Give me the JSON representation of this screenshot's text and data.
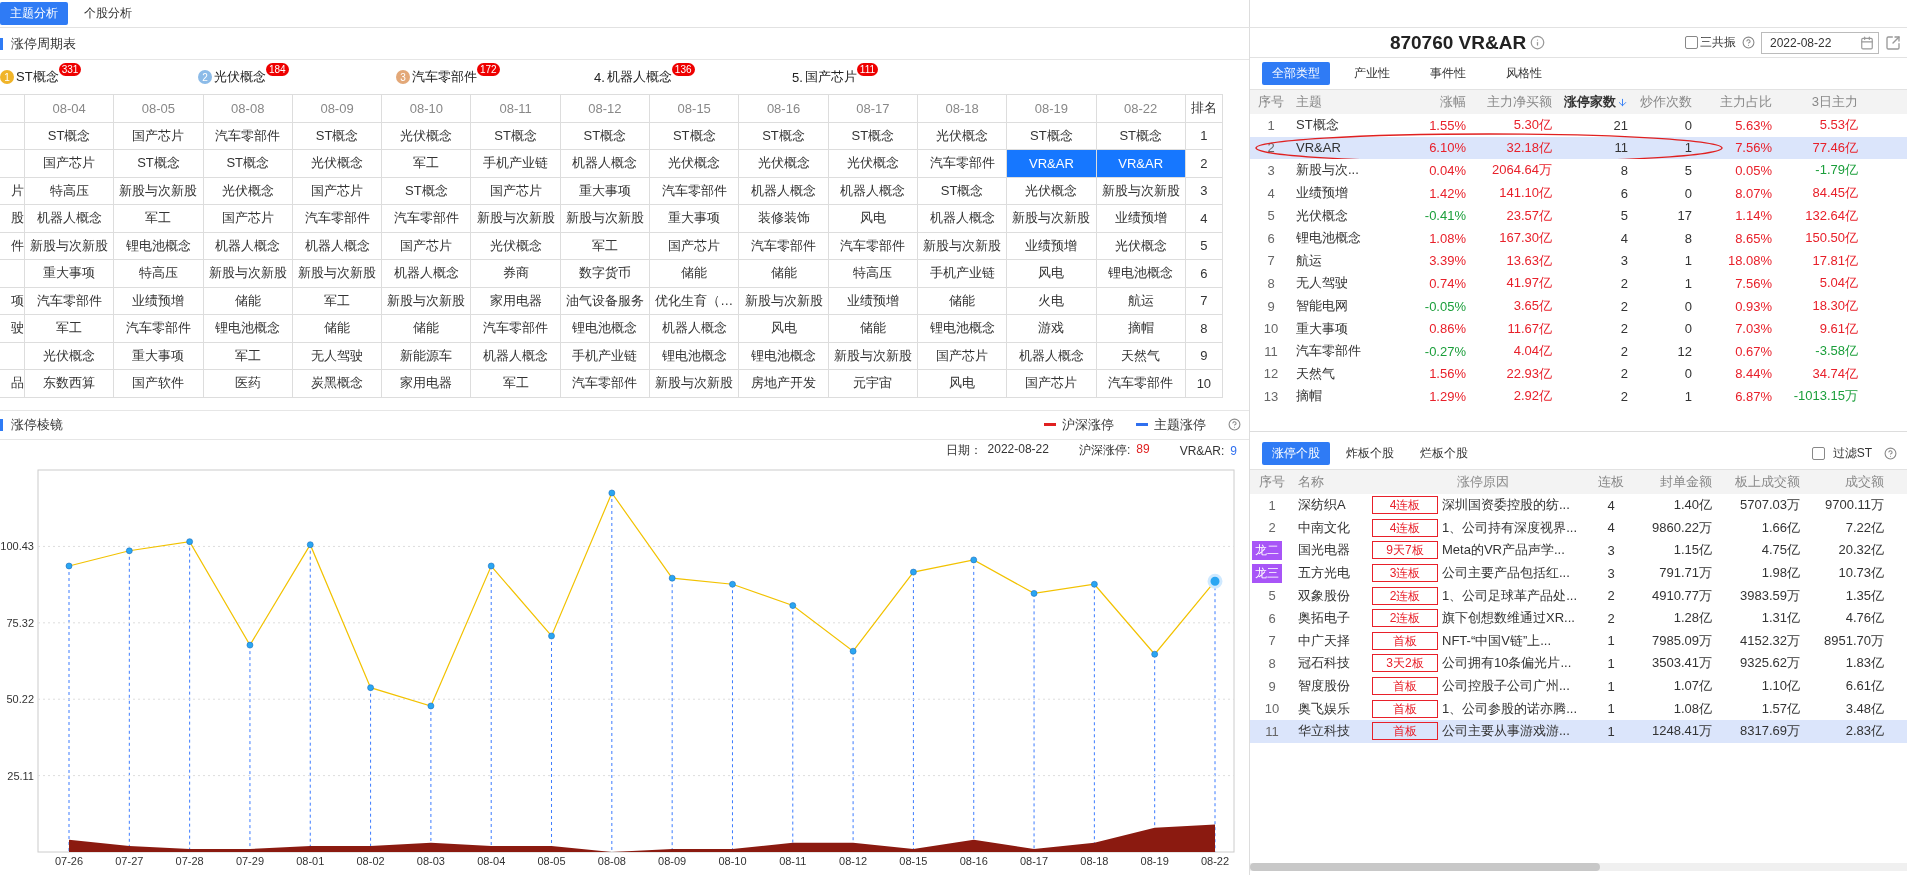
{
  "top_tabs": [
    {
      "label": "主题分析",
      "selected": true
    },
    {
      "label": "个股分析",
      "selected": false
    }
  ],
  "cycle": {
    "title": "涨停周期表",
    "leaders": [
      {
        "kind": "medal",
        "rank": "1",
        "color": "#f0b429",
        "name": "ST概念",
        "count": "331"
      },
      {
        "kind": "medal",
        "rank": "2",
        "color": "#8cbbe8",
        "name": "光伏概念",
        "count": "184"
      },
      {
        "kind": "medal",
        "rank": "3",
        "color": "#e3a878",
        "name": "汽车零部件",
        "count": "172"
      },
      {
        "kind": "plain",
        "rank": "4.",
        "name": "机器人概念",
        "count": "136"
      },
      {
        "kind": "plain",
        "rank": "5.",
        "name": "国产芯片",
        "count": "111"
      }
    ],
    "dates": [
      "08-04",
      "08-05",
      "08-08",
      "08-09",
      "08-10",
      "08-11",
      "08-12",
      "08-15",
      "08-16",
      "08-17",
      "08-18",
      "08-19",
      "08-22"
    ],
    "rank_header": "排名",
    "rows": [
      {
        "rank": "1",
        "cells": [
          {
            "text": "ST概念",
            "selected": false
          },
          {
            "text": "国产芯片",
            "selected": false
          },
          {
            "text": "汽车零部件",
            "selected": false
          },
          {
            "text": "ST概念",
            "selected": false
          },
          {
            "text": "光伏概念",
            "selected": false
          },
          {
            "text": "ST概念",
            "selected": false
          },
          {
            "text": "ST概念",
            "selected": false
          },
          {
            "text": "ST概念",
            "selected": false
          },
          {
            "text": "ST概念",
            "selected": false
          },
          {
            "text": "ST概念",
            "selected": false
          },
          {
            "text": "光伏概念",
            "selected": false
          },
          {
            "text": "ST概念",
            "selected": false
          },
          {
            "text": "ST概念",
            "selected": false
          }
        ]
      },
      {
        "rank": "2",
        "cells": [
          {
            "text": "国产芯片",
            "selected": false
          },
          {
            "text": "ST概念",
            "selected": false
          },
          {
            "text": "ST概念",
            "selected": false
          },
          {
            "text": "光伏概念",
            "selected": false
          },
          {
            "text": "军工",
            "selected": false
          },
          {
            "text": "手机产业链",
            "selected": false
          },
          {
            "text": "机器人概念",
            "selected": false
          },
          {
            "text": "光伏概念",
            "selected": false
          },
          {
            "text": "光伏概念",
            "selected": false
          },
          {
            "text": "光伏概念",
            "selected": false
          },
          {
            "text": "汽车零部件",
            "selected": false
          },
          {
            "text": "VR&AR",
            "selected": true
          },
          {
            "text": "VR&AR",
            "selected": true
          }
        ]
      },
      {
        "rank": "3",
        "cut": "片",
        "cells": [
          {
            "text": "特高压",
            "selected": false
          },
          {
            "text": "新股与次新股",
            "selected": false
          },
          {
            "text": "光伏概念",
            "selected": false
          },
          {
            "text": "国产芯片",
            "selected": false
          },
          {
            "text": "ST概念",
            "selected": false
          },
          {
            "text": "国产芯片",
            "selected": false
          },
          {
            "text": "重大事项",
            "selected": false
          },
          {
            "text": "汽车零部件",
            "selected": false
          },
          {
            "text": "机器人概念",
            "selected": false
          },
          {
            "text": "机器人概念",
            "selected": false
          },
          {
            "text": "ST概念",
            "selected": false
          },
          {
            "text": "光伏概念",
            "selected": false
          },
          {
            "text": "新股与次新股",
            "selected": false
          }
        ]
      },
      {
        "rank": "4",
        "cut": "股",
        "cells": [
          {
            "text": "机器人概念",
            "selected": false
          },
          {
            "text": "军工",
            "selected": false
          },
          {
            "text": "国产芯片",
            "selected": false
          },
          {
            "text": "汽车零部件",
            "selected": false
          },
          {
            "text": "汽车零部件",
            "selected": false
          },
          {
            "text": "新股与次新股",
            "selected": false
          },
          {
            "text": "新股与次新股",
            "selected": false
          },
          {
            "text": "重大事项",
            "selected": false
          },
          {
            "text": "装修装饰",
            "selected": false
          },
          {
            "text": "风电",
            "selected": false
          },
          {
            "text": "机器人概念",
            "selected": false
          },
          {
            "text": "新股与次新股",
            "selected": false
          },
          {
            "text": "业绩预增",
            "selected": false
          }
        ]
      },
      {
        "rank": "5",
        "cut": "件",
        "cells": [
          {
            "text": "新股与次新股",
            "selected": false
          },
          {
            "text": "锂电池概念",
            "selected": false
          },
          {
            "text": "机器人概念",
            "selected": false
          },
          {
            "text": "机器人概念",
            "selected": false
          },
          {
            "text": "国产芯片",
            "selected": false
          },
          {
            "text": "光伏概念",
            "selected": false
          },
          {
            "text": "军工",
            "selected": false
          },
          {
            "text": "国产芯片",
            "selected": false
          },
          {
            "text": "汽车零部件",
            "selected": false
          },
          {
            "text": "汽车零部件",
            "selected": false
          },
          {
            "text": "新股与次新股",
            "selected": false
          },
          {
            "text": "业绩预增",
            "selected": false
          },
          {
            "text": "光伏概念",
            "selected": false
          }
        ]
      },
      {
        "rank": "6",
        "cells": [
          {
            "text": "重大事项",
            "selected": false
          },
          {
            "text": "特高压",
            "selected": false
          },
          {
            "text": "新股与次新股",
            "selected": false
          },
          {
            "text": "新股与次新股",
            "selected": false
          },
          {
            "text": "机器人概念",
            "selected": false
          },
          {
            "text": "券商",
            "selected": false
          },
          {
            "text": "数字货币",
            "selected": false
          },
          {
            "text": "储能",
            "selected": false
          },
          {
            "text": "储能",
            "selected": false
          },
          {
            "text": "特高压",
            "selected": false
          },
          {
            "text": "手机产业链",
            "selected": false
          },
          {
            "text": "风电",
            "selected": false
          },
          {
            "text": "锂电池概念",
            "selected": false
          }
        ]
      },
      {
        "rank": "7",
        "cut": "项",
        "cells": [
          {
            "text": "汽车零部件",
            "selected": false
          },
          {
            "text": "业绩预增",
            "selected": false
          },
          {
            "text": "储能",
            "selected": false
          },
          {
            "text": "军工",
            "selected": false
          },
          {
            "text": "新股与次新股",
            "selected": false
          },
          {
            "text": "家用电器",
            "selected": false
          },
          {
            "text": "油气设备服务",
            "selected": false
          },
          {
            "text": "优化生育（…",
            "selected": false
          },
          {
            "text": "新股与次新股",
            "selected": false
          },
          {
            "text": "业绩预增",
            "selected": false
          },
          {
            "text": "储能",
            "selected": false
          },
          {
            "text": "火电",
            "selected": false
          },
          {
            "text": "航运",
            "selected": false
          }
        ]
      },
      {
        "rank": "8",
        "cut": "驶",
        "cells": [
          {
            "text": "军工",
            "selected": false
          },
          {
            "text": "汽车零部件",
            "selected": false
          },
          {
            "text": "锂电池概念",
            "selected": false
          },
          {
            "text": "储能",
            "selected": false
          },
          {
            "text": "储能",
            "selected": false
          },
          {
            "text": "汽车零部件",
            "selected": false
          },
          {
            "text": "锂电池概念",
            "selected": false
          },
          {
            "text": "机器人概念",
            "selected": false
          },
          {
            "text": "风电",
            "selected": false
          },
          {
            "text": "储能",
            "selected": false
          },
          {
            "text": "锂电池概念",
            "selected": false
          },
          {
            "text": "游戏",
            "selected": false
          },
          {
            "text": "摘帽",
            "selected": false
          }
        ]
      },
      {
        "rank": "9",
        "cells": [
          {
            "text": "光伏概念",
            "selected": false
          },
          {
            "text": "重大事项",
            "selected": false
          },
          {
            "text": "军工",
            "selected": false
          },
          {
            "text": "无人驾驶",
            "selected": false
          },
          {
            "text": "新能源车",
            "selected": false
          },
          {
            "text": "机器人概念",
            "selected": false
          },
          {
            "text": "手机产业链",
            "selected": false
          },
          {
            "text": "锂电池概念",
            "selected": false
          },
          {
            "text": "锂电池概念",
            "selected": false
          },
          {
            "text": "新股与次新股",
            "selected": false
          },
          {
            "text": "国产芯片",
            "selected": false
          },
          {
            "text": "机器人概念",
            "selected": false
          },
          {
            "text": "天然气",
            "selected": false
          }
        ]
      },
      {
        "rank": "10",
        "cut": "品",
        "cells": [
          {
            "text": "东数西算",
            "selected": false
          },
          {
            "text": "国产软件",
            "selected": false
          },
          {
            "text": "医药",
            "selected": false
          },
          {
            "text": "炭黑概念",
            "selected": false
          },
          {
            "text": "家用电器",
            "selected": false
          },
          {
            "text": "军工",
            "selected": false
          },
          {
            "text": "汽车零部件",
            "selected": false
          },
          {
            "text": "新股与次新股",
            "selected": false
          },
          {
            "text": "房地产开发",
            "selected": false
          },
          {
            "text": "元宇宙",
            "selected": false
          },
          {
            "text": "风电",
            "selected": false
          },
          {
            "text": "国产芯片",
            "selected": false
          },
          {
            "text": "汽车零部件",
            "selected": false
          }
        ]
      }
    ]
  },
  "prism": {
    "title": "涨停棱镜",
    "drop_lines": true,
    "legend": [
      {
        "color": "#e02020"
      },
      {
        "color": "#2f6fef"
      }
    ],
    "info": [
      {
        "label": "日期：",
        "value": "2022-08-22",
        "color": "#333333"
      },
      {
        "label": "沪深涨停:",
        "value": "89",
        "color": "#e02020"
      },
      {
        "label": "VR&AR:",
        "value": "9",
        "color": "#2f6fef"
      }
    ],
    "chart_data": {
      "type": "line",
      "categories": [
        "07-26",
        "07-27",
        "07-28",
        "07-29",
        "08-01",
        "08-02",
        "08-03",
        "08-04",
        "08-05",
        "08-08",
        "08-09",
        "08-10",
        "08-11",
        "08-12",
        "08-15",
        "08-16",
        "08-17",
        "08-18",
        "08-19",
        "08-22"
      ],
      "series": [
        {
          "name": "沪深涨停",
          "type": "line",
          "marker": true,
          "color": "#f2c200",
          "values": [
            94,
            99,
            102,
            68,
            101,
            54,
            48,
            94,
            71,
            118,
            90,
            88,
            81,
            66,
            92,
            96,
            85,
            88,
            65,
            89
          ]
        },
        {
          "name": "主题涨停",
          "type": "area",
          "color": "#8b1a10",
          "values": [
            4,
            2,
            1,
            1,
            2,
            2,
            3,
            2,
            2,
            0,
            1,
            1,
            3,
            3,
            1,
            4,
            1,
            3,
            8,
            9
          ]
        }
      ],
      "grid": true,
      "ylim": [
        0,
        125.55
      ],
      "yticks": [
        25.11,
        50.22,
        75.32,
        100.43
      ]
    }
  },
  "theme": {
    "title": "870760 VR&AR",
    "resonance": {
      "label": "三共振",
      "checked": false
    },
    "date": "2022-08-22",
    "tabs": [
      {
        "label": "全部类型",
        "selected": true
      },
      {
        "label": "产业性",
        "selected": false
      },
      {
        "label": "事件性",
        "selected": false
      },
      {
        "label": "风格性",
        "selected": false
      }
    ],
    "columns": [
      {
        "label": "序号",
        "sorted": false
      },
      {
        "label": "主题",
        "sorted": false
      },
      {
        "label": "涨幅",
        "sorted": false
      },
      {
        "label": "主力净买额",
        "sorted": false
      },
      {
        "label": "涨停家数",
        "sorted": true
      },
      {
        "label": "炒作次数",
        "sorted": false
      },
      {
        "label": "主力占比",
        "sorted": false
      },
      {
        "label": "3日主力",
        "sorted": false
      }
    ],
    "rows": [
      {
        "seq": "1",
        "theme": "ST概念",
        "change": "1.55%",
        "change_up": true,
        "net_buy": "5.30亿",
        "limit_count": "21",
        "hype_count": "0",
        "main_ratio": "5.63%",
        "main_3d": "5.53亿",
        "main_3d_up": true,
        "selected": false,
        "circled": false
      },
      {
        "seq": "2",
        "theme": "VR&AR",
        "change": "6.10%",
        "change_up": true,
        "net_buy": "32.18亿",
        "limit_count": "11",
        "hype_count": "1",
        "main_ratio": "7.56%",
        "main_3d": "77.46亿",
        "main_3d_up": true,
        "selected": true,
        "circled": true
      },
      {
        "seq": "3",
        "theme": "新股与次...",
        "change": "0.04%",
        "change_up": true,
        "net_buy": "2064.64万",
        "limit_count": "8",
        "hype_count": "5",
        "main_ratio": "0.05%",
        "main_3d": "-1.79亿",
        "main_3d_up": false,
        "selected": false,
        "circled": false
      },
      {
        "seq": "4",
        "theme": "业绩预增",
        "change": "1.42%",
        "change_up": true,
        "net_buy": "141.10亿",
        "limit_count": "6",
        "hype_count": "0",
        "main_ratio": "8.07%",
        "main_3d": "84.45亿",
        "main_3d_up": true,
        "selected": false,
        "circled": false
      },
      {
        "seq": "5",
        "theme": "光伏概念",
        "change": "-0.41%",
        "change_up": false,
        "net_buy": "23.57亿",
        "limit_count": "5",
        "hype_count": "17",
        "main_ratio": "1.14%",
        "main_3d": "132.64亿",
        "main_3d_up": true,
        "selected": false,
        "circled": false
      },
      {
        "seq": "6",
        "theme": "锂电池概念",
        "change": "1.08%",
        "change_up": true,
        "net_buy": "167.30亿",
        "limit_count": "4",
        "hype_count": "8",
        "main_ratio": "8.65%",
        "main_3d": "150.50亿",
        "main_3d_up": true,
        "selected": false,
        "circled": false
      },
      {
        "seq": "7",
        "theme": "航运",
        "change": "3.39%",
        "change_up": true,
        "net_buy": "13.63亿",
        "limit_count": "3",
        "hype_count": "1",
        "main_ratio": "18.08%",
        "main_3d": "17.81亿",
        "main_3d_up": true,
        "selected": false,
        "circled": false
      },
      {
        "seq": "8",
        "theme": "无人驾驶",
        "change": "0.74%",
        "change_up": true,
        "net_buy": "41.97亿",
        "limit_count": "2",
        "hype_count": "1",
        "main_ratio": "7.56%",
        "main_3d": "5.04亿",
        "main_3d_up": true,
        "selected": false,
        "circled": false
      },
      {
        "seq": "9",
        "theme": "智能电网",
        "change": "-0.05%",
        "change_up": false,
        "net_buy": "3.65亿",
        "limit_count": "2",
        "hype_count": "0",
        "main_ratio": "0.93%",
        "main_3d": "18.30亿",
        "main_3d_up": true,
        "selected": false,
        "circled": false
      },
      {
        "seq": "10",
        "theme": "重大事项",
        "change": "0.86%",
        "change_up": true,
        "net_buy": "11.67亿",
        "limit_count": "2",
        "hype_count": "0",
        "main_ratio": "7.03%",
        "main_3d": "9.61亿",
        "main_3d_up": true,
        "selected": false,
        "circled": false
      },
      {
        "seq": "11",
        "theme": "汽车零部件",
        "change": "-0.27%",
        "change_up": false,
        "net_buy": "4.04亿",
        "limit_count": "2",
        "hype_count": "12",
        "main_ratio": "0.67%",
        "main_3d": "-3.58亿",
        "main_3d_up": false,
        "selected": false,
        "circled": false
      },
      {
        "seq": "12",
        "theme": "天然气",
        "change": "1.56%",
        "change_up": true,
        "net_buy": "22.93亿",
        "limit_count": "2",
        "hype_count": "0",
        "main_ratio": "8.44%",
        "main_3d": "34.74亿",
        "main_3d_up": true,
        "selected": false,
        "circled": false
      },
      {
        "seq": "13",
        "theme": "摘帽",
        "change": "1.29%",
        "change_up": true,
        "net_buy": "2.92亿",
        "limit_count": "2",
        "hype_count": "1",
        "main_ratio": "6.87%",
        "main_3d": "-1013.15万",
        "main_3d_up": false,
        "selected": false,
        "circled": false
      }
    ]
  },
  "stocks": {
    "tabs": [
      {
        "label": "涨停个股",
        "selected": true
      },
      {
        "label": "炸板个股",
        "selected": false
      },
      {
        "label": "烂板个股",
        "selected": false
      }
    ],
    "filter": {
      "label": "过滤ST",
      "checked": false
    },
    "columns": [
      "序号",
      "名称",
      "涨停原因",
      "连板",
      "封单金额",
      "板上成交额",
      "成交额"
    ],
    "rows": [
      {
        "kind": "number",
        "seq": "1",
        "name": "深纺织A",
        "tag": "4连板",
        "reason": "深圳国资委控股的纺...",
        "streak": "4",
        "seal": "1.40亿",
        "board_turnover": "5707.03万",
        "turnover": "9700.11万",
        "selected": false
      },
      {
        "kind": "number",
        "seq": "2",
        "name": "中南文化",
        "tag": "4连板",
        "reason": "1、公司持有深度视界...",
        "streak": "4",
        "seal": "9860.22万",
        "board_turnover": "1.66亿",
        "turnover": "7.22亿",
        "selected": false
      },
      {
        "kind": "badge",
        "seq": "龙二",
        "name": "国光电器",
        "tag": "9天7板",
        "reason": "Meta的VR产品声学...",
        "streak": "3",
        "seal": "1.15亿",
        "board_turnover": "4.75亿",
        "turnover": "20.32亿",
        "selected": false
      },
      {
        "kind": "badge",
        "seq": "龙三",
        "name": "五方光电",
        "tag": "3连板",
        "reason": "公司主要产品包括红...",
        "streak": "3",
        "seal": "791.71万",
        "board_turnover": "1.98亿",
        "turnover": "10.73亿",
        "selected": false
      },
      {
        "kind": "number",
        "seq": "5",
        "name": "双象股份",
        "tag": "2连板",
        "reason": "1、公司足球革产品处...",
        "streak": "2",
        "seal": "4910.77万",
        "board_turnover": "3983.59万",
        "turnover": "1.35亿",
        "selected": false
      },
      {
        "kind": "number",
        "seq": "6",
        "name": "奥拓电子",
        "tag": "2连板",
        "reason": "旗下创想数维通过XR...",
        "streak": "2",
        "seal": "1.28亿",
        "board_turnover": "1.31亿",
        "turnover": "4.76亿",
        "selected": false
      },
      {
        "kind": "number",
        "seq": "7",
        "name": "中广天择",
        "tag": "首板",
        "reason": "NFT-“中国V链”上...",
        "streak": "1",
        "seal": "7985.09万",
        "board_turnover": "4152.32万",
        "turnover": "8951.70万",
        "selected": false
      },
      {
        "kind": "number",
        "seq": "8",
        "name": "冠石科技",
        "tag": "3天2板",
        "reason": "公司拥有10条偏光片...",
        "streak": "1",
        "seal": "3503.41万",
        "board_turnover": "9325.62万",
        "turnover": "1.83亿",
        "selected": false
      },
      {
        "kind": "number",
        "seq": "9",
        "name": "智度股份",
        "tag": "首板",
        "reason": "公司控股子公司广州...",
        "streak": "1",
        "seal": "1.07亿",
        "board_turnover": "1.10亿",
        "turnover": "6.61亿",
        "selected": false
      },
      {
        "kind": "number",
        "seq": "10",
        "name": "奥飞娱乐",
        "tag": "首板",
        "reason": "1、公司参股的诺亦腾...",
        "streak": "1",
        "seal": "1.08亿",
        "board_turnover": "1.57亿",
        "turnover": "3.48亿",
        "selected": false
      },
      {
        "kind": "number",
        "seq": "11",
        "name": "华立科技",
        "tag": "首板",
        "reason": "公司主要从事游戏游...",
        "streak": "1",
        "seal": "1248.41万",
        "board_turnover": "8317.69万",
        "turnover": "2.83亿",
        "selected": true
      }
    ]
  }
}
